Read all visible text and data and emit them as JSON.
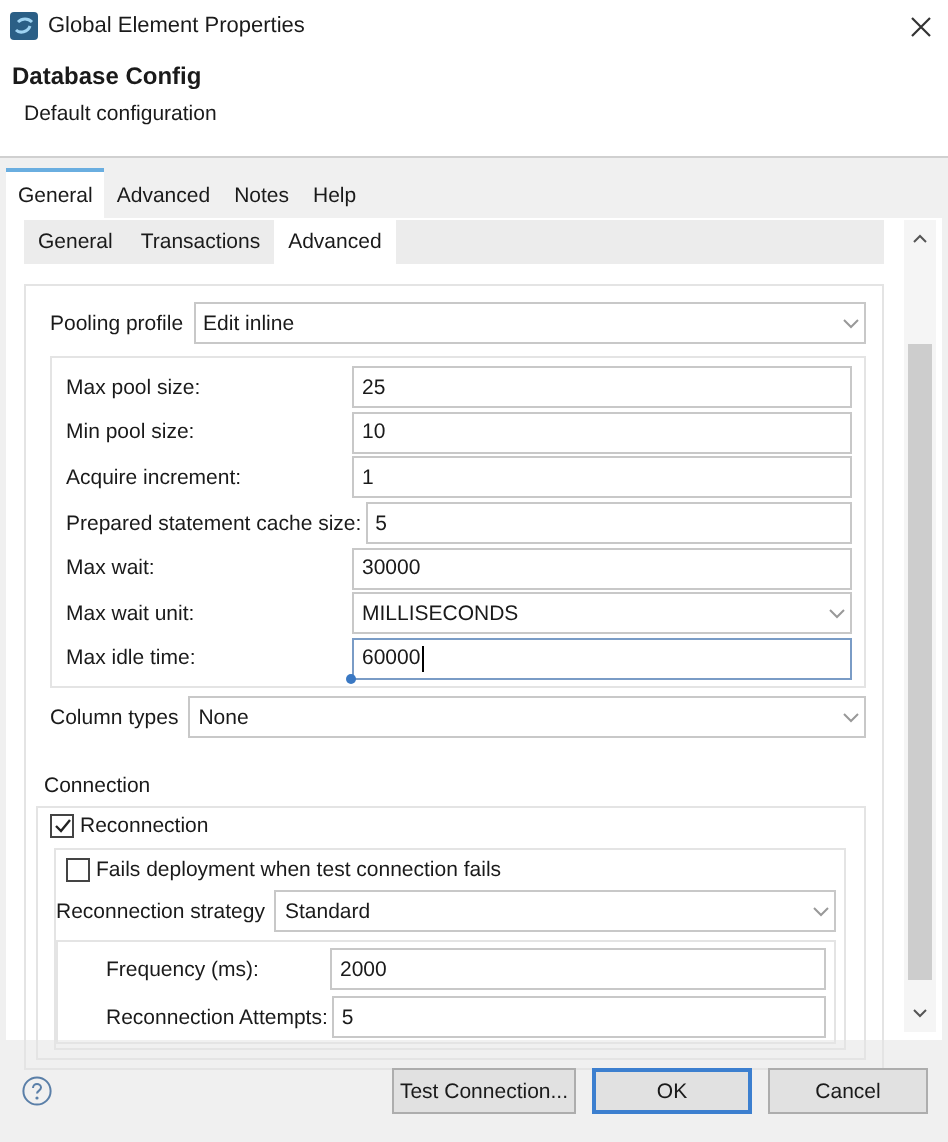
{
  "window": {
    "title": "Global Element Properties"
  },
  "header": {
    "title": "Database Config",
    "subtitle": "Default configuration"
  },
  "tabs": [
    {
      "label": "General",
      "selected": true
    },
    {
      "label": "Advanced",
      "selected": false
    },
    {
      "label": "Notes",
      "selected": false
    },
    {
      "label": "Help",
      "selected": false
    }
  ],
  "subtabs": [
    {
      "label": "General",
      "selected": false
    },
    {
      "label": "Transactions",
      "selected": false
    },
    {
      "label": "Advanced",
      "selected": true
    }
  ],
  "pooling_profile": {
    "label": "Pooling profile",
    "value": "Edit inline"
  },
  "pool_fields": [
    {
      "kind": "text",
      "label": "Max pool size:",
      "value": "25",
      "focused": false
    },
    {
      "kind": "text",
      "label": "Min pool size:",
      "value": "10",
      "focused": false
    },
    {
      "kind": "text",
      "label": "Acquire increment:",
      "value": "1",
      "focused": false
    },
    {
      "kind": "text",
      "label": "Prepared statement cache size:",
      "value": "5",
      "focused": false
    },
    {
      "kind": "text",
      "label": "Max wait:",
      "value": "30000",
      "focused": false
    },
    {
      "kind": "select",
      "label": "Max wait unit:",
      "value": "MILLISECONDS",
      "focused": false
    },
    {
      "kind": "text",
      "label": "Max idle time:",
      "value": "60000",
      "focused": true
    }
  ],
  "column_types": {
    "label": "Column types",
    "value": "None"
  },
  "connection": {
    "label": "Connection",
    "reconnection": {
      "label": "Reconnection",
      "checked": true
    },
    "fails_deployment": {
      "label": "Fails deployment when test connection fails",
      "checked": false
    },
    "strategy": {
      "label": "Reconnection strategy",
      "value": "Standard"
    },
    "fields": [
      {
        "label": "Frequency (ms):",
        "value": "2000"
      },
      {
        "label": "Reconnection Attempts:",
        "value": "5"
      }
    ]
  },
  "buttons": [
    {
      "label": "Test Connection...",
      "default": false
    },
    {
      "label": "OK",
      "default": true
    },
    {
      "label": "Cancel",
      "default": false
    }
  ]
}
